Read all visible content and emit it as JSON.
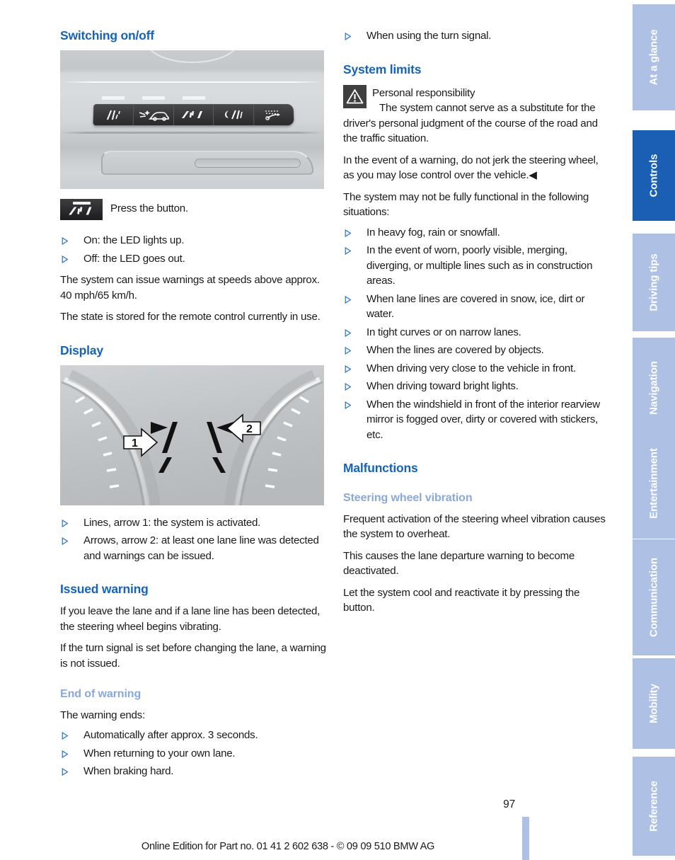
{
  "document": {
    "page_number": "97",
    "footer_note": "Online Edition for Part no. 01 41 2 602 638 - © 09 09 510 BMW AG"
  },
  "sidebar": {
    "tabs": [
      {
        "label": "At a glance",
        "active": false
      },
      {
        "label": "Controls",
        "active": true
      },
      {
        "label": "Driving tips",
        "active": false
      },
      {
        "label": "Navigation",
        "active": false
      },
      {
        "label": "Entertainment",
        "active": false
      },
      {
        "label": "Communication",
        "active": false
      },
      {
        "label": "Mobility",
        "active": false
      },
      {
        "label": "Reference",
        "active": false
      }
    ],
    "colors": {
      "active": "#1a5fb4",
      "inactive": "#aec1e4",
      "label": "#ffffff"
    }
  },
  "colors": {
    "heading_blue": "#1763b5",
    "subheading_blue": "#8aa8da",
    "bullet_blue": "#2f6fc0",
    "body_text": "#1a1a1a",
    "warning_icon_bg": "#3f3f3f"
  },
  "left_column": {
    "switching": {
      "heading": "Switching on/off",
      "figure_alt": "Center console button bank with lane departure warning button",
      "legend_text": "Press the button.",
      "bullets": [
        "On: the LED lights up.",
        "Off: the LED goes out."
      ],
      "paragraphs": [
        "The system can issue warnings at speeds above approx. 40 mph/65 km/h.",
        "The state is stored for the remote control currently in use."
      ]
    },
    "display": {
      "heading": "Display",
      "figure_alt": "Instrument cluster lane departure warning display with callouts 1 and 2",
      "callouts": [
        "1",
        "2"
      ],
      "bullets": [
        "Lines, arrow 1: the system is activated.",
        "Arrows, arrow 2: at least one lane line was detected and warnings can be issued."
      ]
    },
    "issued_warning": {
      "heading": "Issued warning",
      "paragraphs": [
        "If you leave the lane and if a lane line has been detected, the steering wheel begins vibrating.",
        "If the turn signal is set before changing the lane, a warning is not issued."
      ]
    },
    "end_of_warning": {
      "heading": "End of warning",
      "intro": "The warning ends:",
      "bullets": [
        "Automatically after approx. 3 seconds.",
        "When returning to your own lane.",
        "When braking hard."
      ]
    }
  },
  "right_column": {
    "carryover_bullet": "When using the turn signal.",
    "system_limits": {
      "heading": "System limits",
      "warning": {
        "icon": "warning-triangle-icon",
        "title": "Personal responsibility",
        "body": "The system cannot serve as a substitute for the driver's personal judgment of the course of the road and the traffic situation.",
        "body2": "In the event of a warning, do not jerk the steering wheel, as you may lose control over the vehicle.",
        "end_mark": "◀"
      },
      "intro": "The system may not be fully functional in the following situations:",
      "bullets": [
        "In heavy fog, rain or snowfall.",
        "In the event of worn, poorly visible, merging, diverging, or multiple lines such as in construction areas.",
        "When lane lines are covered in snow, ice, dirt or water.",
        "In tight curves or on narrow lanes.",
        "When the lines are covered by objects.",
        "When driving very close to the vehicle in front.",
        "When driving toward bright lights.",
        "When the windshield in front of the interior rearview mirror is fogged over, dirty or covered with stickers, etc."
      ]
    },
    "malfunctions": {
      "heading": "Malfunctions",
      "subheading": "Steering wheel vibration",
      "paragraphs": [
        "Frequent activation of the steering wheel vibration causes the system to overheat.",
        "This causes the lane departure warning to become deactivated.",
        "Let the system cool and reactivate it by pressing the button."
      ]
    }
  }
}
